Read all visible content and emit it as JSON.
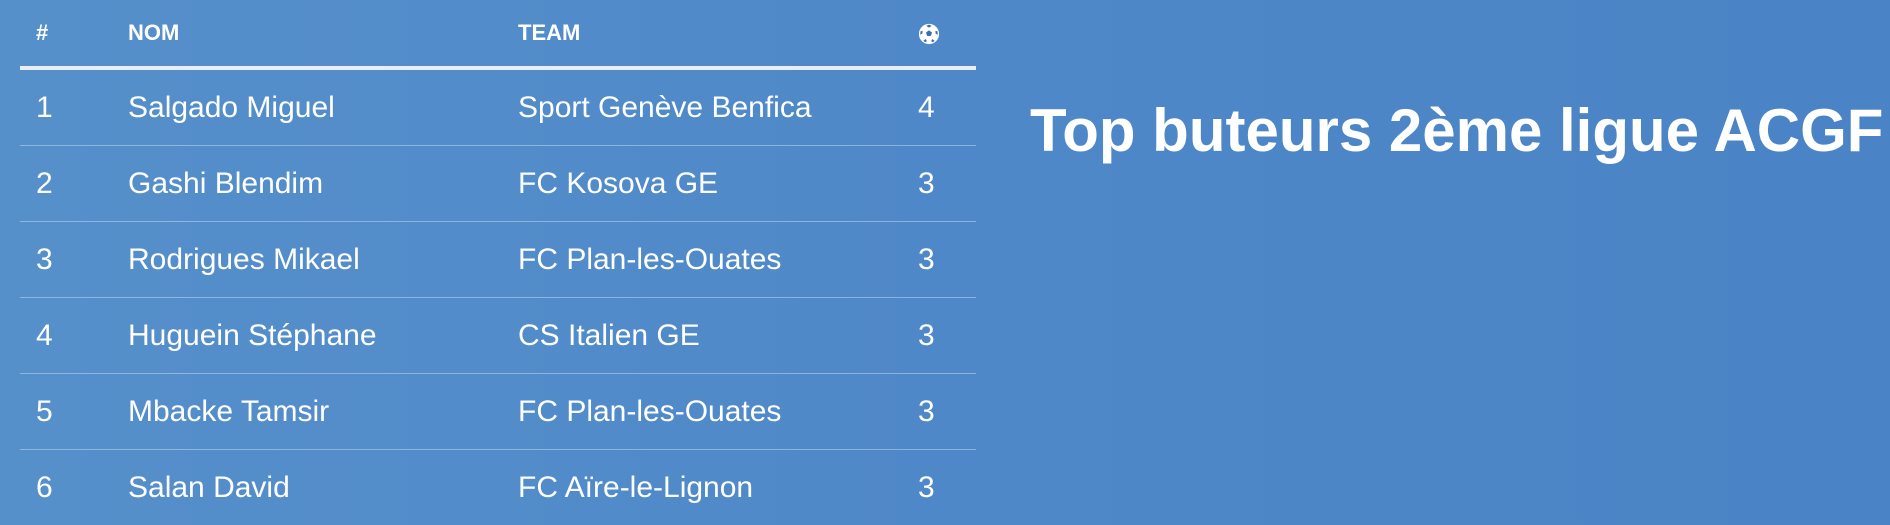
{
  "title": "Top buteurs 2ème ligue ACGF",
  "table": {
    "headers": {
      "rank": "#",
      "name": "NOM",
      "team": "TEAM",
      "goals_icon": "soccer-ball-icon"
    },
    "rows": [
      {
        "rank": "1",
        "name": "Salgado Miguel",
        "team": "Sport Genève Benfica",
        "goals": "4"
      },
      {
        "rank": "2",
        "name": "Gashi Blendim",
        "team": "FC Kosova GE",
        "goals": "3"
      },
      {
        "rank": "3",
        "name": "Rodrigues Mikael",
        "team": "FC Plan-les-Ouates",
        "goals": "3"
      },
      {
        "rank": "4",
        "name": "Huguein Stéphane",
        "team": "CS Italien GE",
        "goals": "3"
      },
      {
        "rank": "5",
        "name": "Mbacke Tamsir",
        "team": "FC Plan-les-Ouates",
        "goals": "3"
      },
      {
        "rank": "6",
        "name": "Salan David",
        "team": "FC Aïre-le-Lignon",
        "goals": "3"
      }
    ]
  },
  "colors": {
    "background": "#4f88c8",
    "text": "#ffffff",
    "header_rule": "#e9eef4"
  }
}
